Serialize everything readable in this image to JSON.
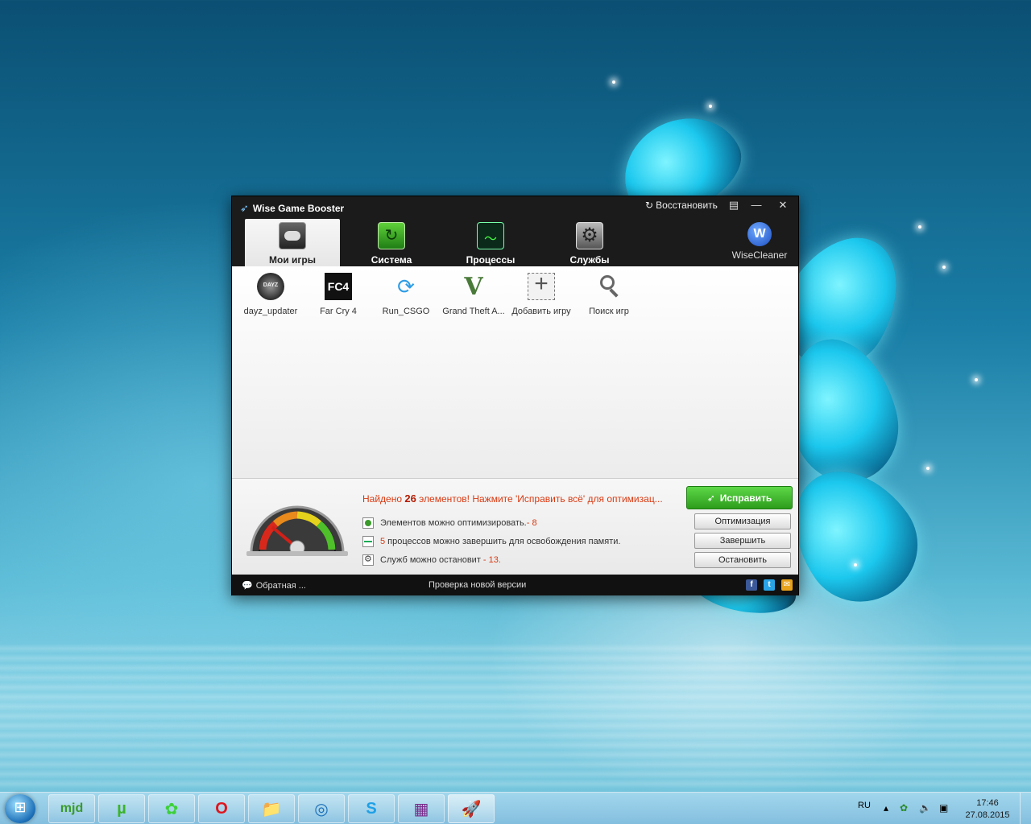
{
  "window": {
    "title": "Wise Game Booster",
    "restore_label": "Восстановить",
    "controls": {
      "menu": "▤",
      "minimize": "—",
      "close": "✕"
    }
  },
  "tabs": [
    {
      "label": "Мои игры",
      "icon": "gamepad-icon"
    },
    {
      "label": "Система",
      "icon": "system-optimize-icon"
    },
    {
      "label": "Процессы",
      "icon": "process-monitor-icon"
    },
    {
      "label": "Службы",
      "icon": "services-gear-icon"
    }
  ],
  "brand": {
    "logo_letter": "W",
    "name": "WiseCleaner"
  },
  "games": [
    {
      "label": "dayz_updater",
      "icon": "dayz-icon"
    },
    {
      "label": "Far Cry 4",
      "icon": "farcry4-icon",
      "badge": "FC4"
    },
    {
      "label": "Run_CSGO",
      "icon": "csgo-icon"
    },
    {
      "label": "Grand Theft A...",
      "icon": "gta-icon"
    },
    {
      "label": "Добавить игру",
      "icon": "add-game-icon"
    },
    {
      "label": "Поиск игр",
      "icon": "search-games-icon"
    }
  ],
  "summary": {
    "headline_prefix": "Найдено ",
    "headline_count": "26",
    "headline_suffix": " элементов! Нажмите 'Исправить всё' для оптимизац...",
    "rows": [
      {
        "text": "Элементов можно оптимизировать.",
        "num": "- 8"
      },
      {
        "num": "5",
        "text": " процессов можно завершить для освобождения памяти."
      },
      {
        "text": "Служб можно остановит",
        "num": " - 13."
      }
    ],
    "fix_label": "Исправить",
    "buttons": [
      "Оптимизация",
      "Завершить",
      "Остановить"
    ]
  },
  "footer": {
    "feedback": "Обратная ...",
    "check_version": "Проверка новой версии",
    "social": [
      "f",
      "t",
      "✉"
    ]
  },
  "taskbar": {
    "apps": [
      "mjd",
      "µ",
      "✿",
      "O",
      "📁",
      "◎",
      "S",
      "▦",
      "🚀"
    ],
    "lang": "RU",
    "time": "17:46",
    "date": "27.08.2015"
  },
  "colors": {
    "accent_green": "#3fb52a",
    "warning": "#d83a12",
    "window_bg": "#1b1b1b"
  }
}
